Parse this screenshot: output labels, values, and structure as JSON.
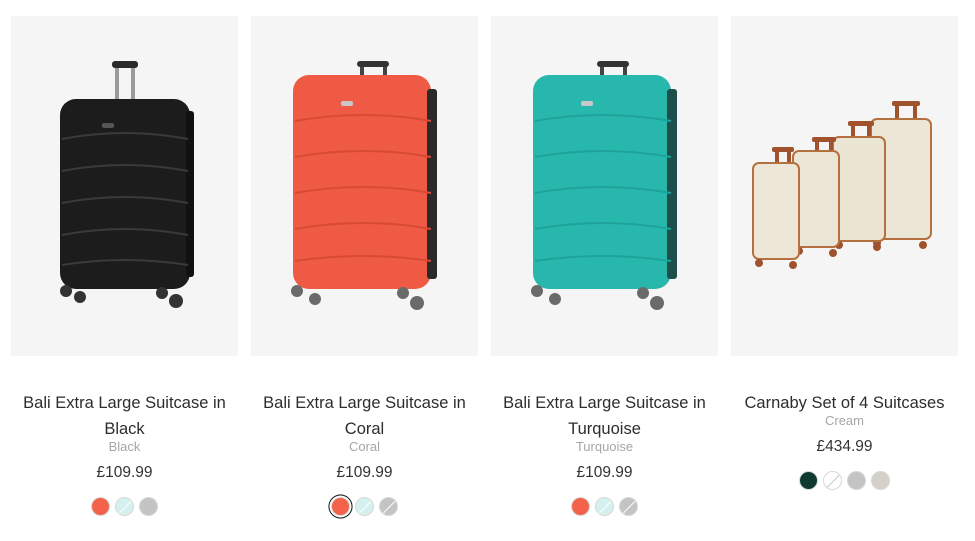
{
  "products": [
    {
      "title": "Bali Extra Large Suitcase in Black",
      "variant": "Black",
      "price": "£109.99",
      "color": "#1e1e1e",
      "swatches": [
        {
          "name": "coral",
          "color": "#f26349",
          "selected": false,
          "unavailable": false
        },
        {
          "name": "turquoise",
          "color": "#d5f1ef",
          "selected": false,
          "unavailable": true
        },
        {
          "name": "silver",
          "color": "#c4c4c4",
          "selected": false,
          "unavailable": false
        }
      ]
    },
    {
      "title": "Bali Extra Large Suitcase in Coral",
      "variant": "Coral",
      "price": "£109.99",
      "color": "#ee5a44",
      "swatches": [
        {
          "name": "coral",
          "color": "#f26349",
          "selected": true,
          "unavailable": false
        },
        {
          "name": "turquoise",
          "color": "#d5f1ef",
          "selected": false,
          "unavailable": true
        },
        {
          "name": "silver",
          "color": "#c4c4c4",
          "selected": false,
          "unavailable": true
        }
      ]
    },
    {
      "title": "Bali Extra Large Suitcase in Turquoise",
      "variant": "Turquoise",
      "price": "£109.99",
      "color": "#28b7ad",
      "swatches": [
        {
          "name": "coral",
          "color": "#f26349",
          "selected": false,
          "unavailable": false
        },
        {
          "name": "turquoise",
          "color": "#d5f1ef",
          "selected": false,
          "unavailable": true
        },
        {
          "name": "silver",
          "color": "#c4c4c4",
          "selected": false,
          "unavailable": true
        }
      ]
    },
    {
      "title": "Carnaby Set of 4 Suitcases",
      "variant": "Cream",
      "price": "£434.99",
      "color": "#ece6d6",
      "swatches": [
        {
          "name": "green",
          "color": "#0f3b2e",
          "selected": false,
          "unavailable": false
        },
        {
          "name": "cream",
          "color": "#ffffff",
          "selected": false,
          "unavailable": true
        },
        {
          "name": "grey",
          "color": "#c4c4c4",
          "selected": false,
          "unavailable": false
        },
        {
          "name": "beige",
          "color": "#d4d2c8",
          "selected": false,
          "unavailable": false
        }
      ]
    }
  ]
}
